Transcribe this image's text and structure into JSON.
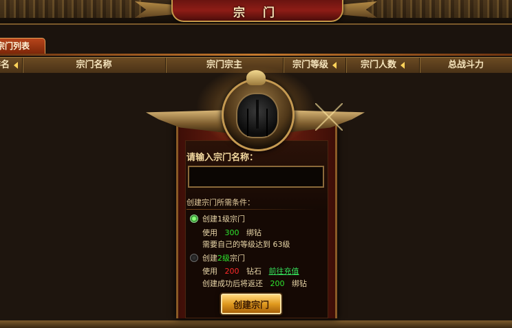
{
  "window": {
    "title": "宗 门"
  },
  "tabs": [
    {
      "label": "宗门列表"
    }
  ],
  "table": {
    "columns": [
      {
        "label": "排名",
        "sortable": true
      },
      {
        "label": "宗门名称",
        "sortable": false
      },
      {
        "label": "宗门宗主",
        "sortable": false
      },
      {
        "label": "宗门等级",
        "sortable": true
      },
      {
        "label": "宗门人数",
        "sortable": true
      },
      {
        "label": "总战斗力",
        "sortable": false
      }
    ]
  },
  "dialog": {
    "prompt": "请输入宗门名称：",
    "name_input": {
      "value": "",
      "placeholder": ""
    },
    "requirements_title": "创建宗门所需条件：",
    "option1": {
      "title": "创建1级宗门",
      "cost_prefix": "使用",
      "cost_amount": "300",
      "cost_unit": "绑钻",
      "requirement_prefix": "需要自己的等级达到",
      "requirement_level": "63",
      "requirement_suffix": "级",
      "selected": true
    },
    "option2": {
      "title_prefix": "创建",
      "title_level": "2级",
      "title_suffix": "宗门",
      "cost_prefix": "使用",
      "cost_amount": "200",
      "cost_unit": "钻石",
      "recharge_link": "前往充值",
      "refund_prefix": "创建成功后将返还",
      "refund_amount": "200",
      "refund_unit": "绑钻",
      "selected": false
    },
    "create_button": "创建宗门"
  },
  "colors": {
    "accent_gold": "#f3d9a0",
    "value_green": "#2ee52e",
    "value_red": "#ff2a2a",
    "dialog_red": "#641b0e"
  }
}
